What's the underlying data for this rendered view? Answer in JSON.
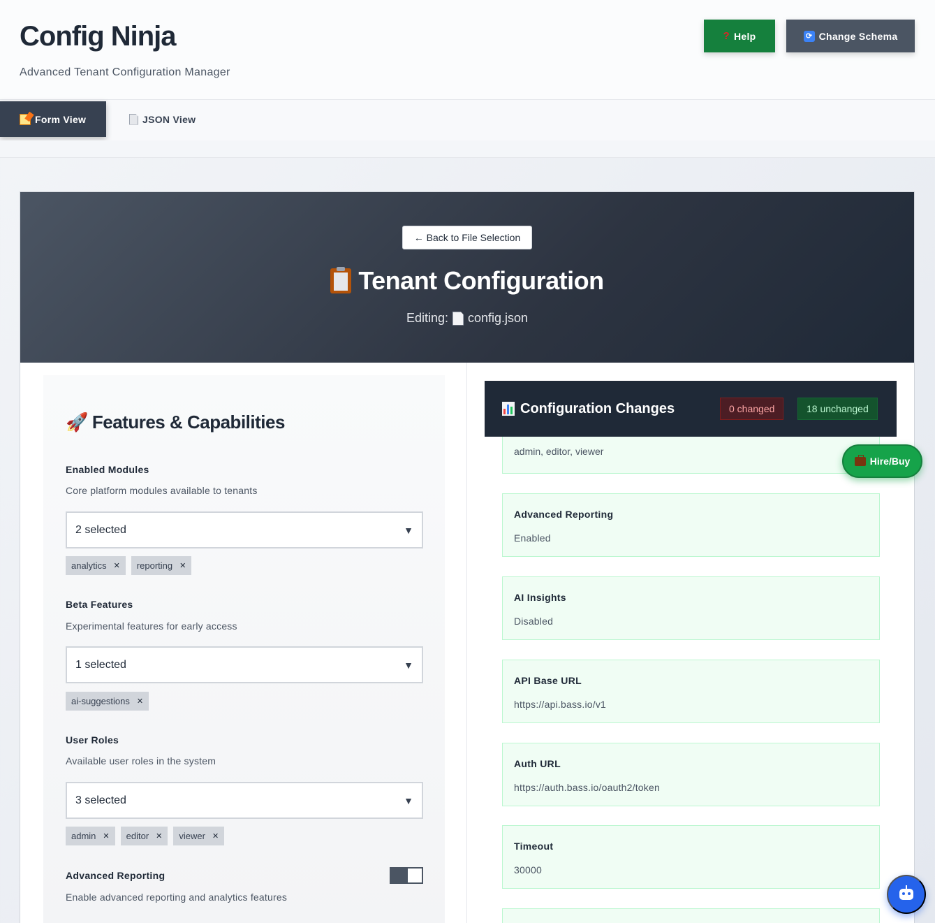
{
  "app": {
    "title": "Config Ninja",
    "subtitle": "Advanced Tenant Configuration Manager"
  },
  "header_buttons": {
    "help": "Help",
    "change_schema": "Change Schema"
  },
  "tabs": [
    {
      "label": "Form View",
      "active": true
    },
    {
      "label": "JSON View",
      "active": false
    }
  ],
  "hero": {
    "back": "← Back to File Selection",
    "title": "Tenant Configuration",
    "editing_label": "Editing:",
    "file_name": "config.json"
  },
  "section": {
    "title": "Features & Capabilities",
    "fields": [
      {
        "label": "Enabled Modules",
        "description": "Core platform modules available to tenants",
        "selected": "2 selected",
        "chips": [
          "analytics",
          "reporting"
        ]
      },
      {
        "label": "Beta Features",
        "description": "Experimental features for early access",
        "selected": "1 selected",
        "chips": [
          "ai-suggestions"
        ]
      },
      {
        "label": "User Roles",
        "description": "Available user roles in the system",
        "selected": "3 selected",
        "chips": [
          "admin",
          "editor",
          "viewer"
        ]
      }
    ],
    "toggle_field": {
      "label": "Advanced Reporting",
      "description": "Enable advanced reporting and analytics features",
      "on": true
    }
  },
  "changes": {
    "title": "Configuration Changes",
    "changed_badge": "0 changed",
    "unchanged_badge": "18 unchanged",
    "partial_value": "admin, editor, viewer",
    "items": [
      {
        "label": "Advanced Reporting",
        "value": "Enabled"
      },
      {
        "label": "AI Insights",
        "value": "Disabled"
      },
      {
        "label": "API Base URL",
        "value": "https://api.bass.io/v1"
      },
      {
        "label": "Auth URL",
        "value": "https://auth.bass.io/oauth2/token"
      },
      {
        "label": "Timeout",
        "value": "30000"
      }
    ]
  },
  "floating": {
    "hire": "Hire/Buy"
  },
  "colors": {
    "help_button": "#15803d",
    "schema_button": "#4b5563",
    "hero_bg": "#2d3441",
    "unchanged_item_bg": "#f0fdf4",
    "hire_button": "#16a34a",
    "bot_button": "#2563eb"
  },
  "icons": {
    "help": "question-mark-icon",
    "schema": "sync-icon",
    "form_tab": "memo-icon",
    "json_tab": "page-icon",
    "title": "clipboard-icon",
    "section": "rocket-icon",
    "changes": "bar-chart-icon",
    "hire": "briefcase-icon",
    "bot": "robot-icon"
  }
}
